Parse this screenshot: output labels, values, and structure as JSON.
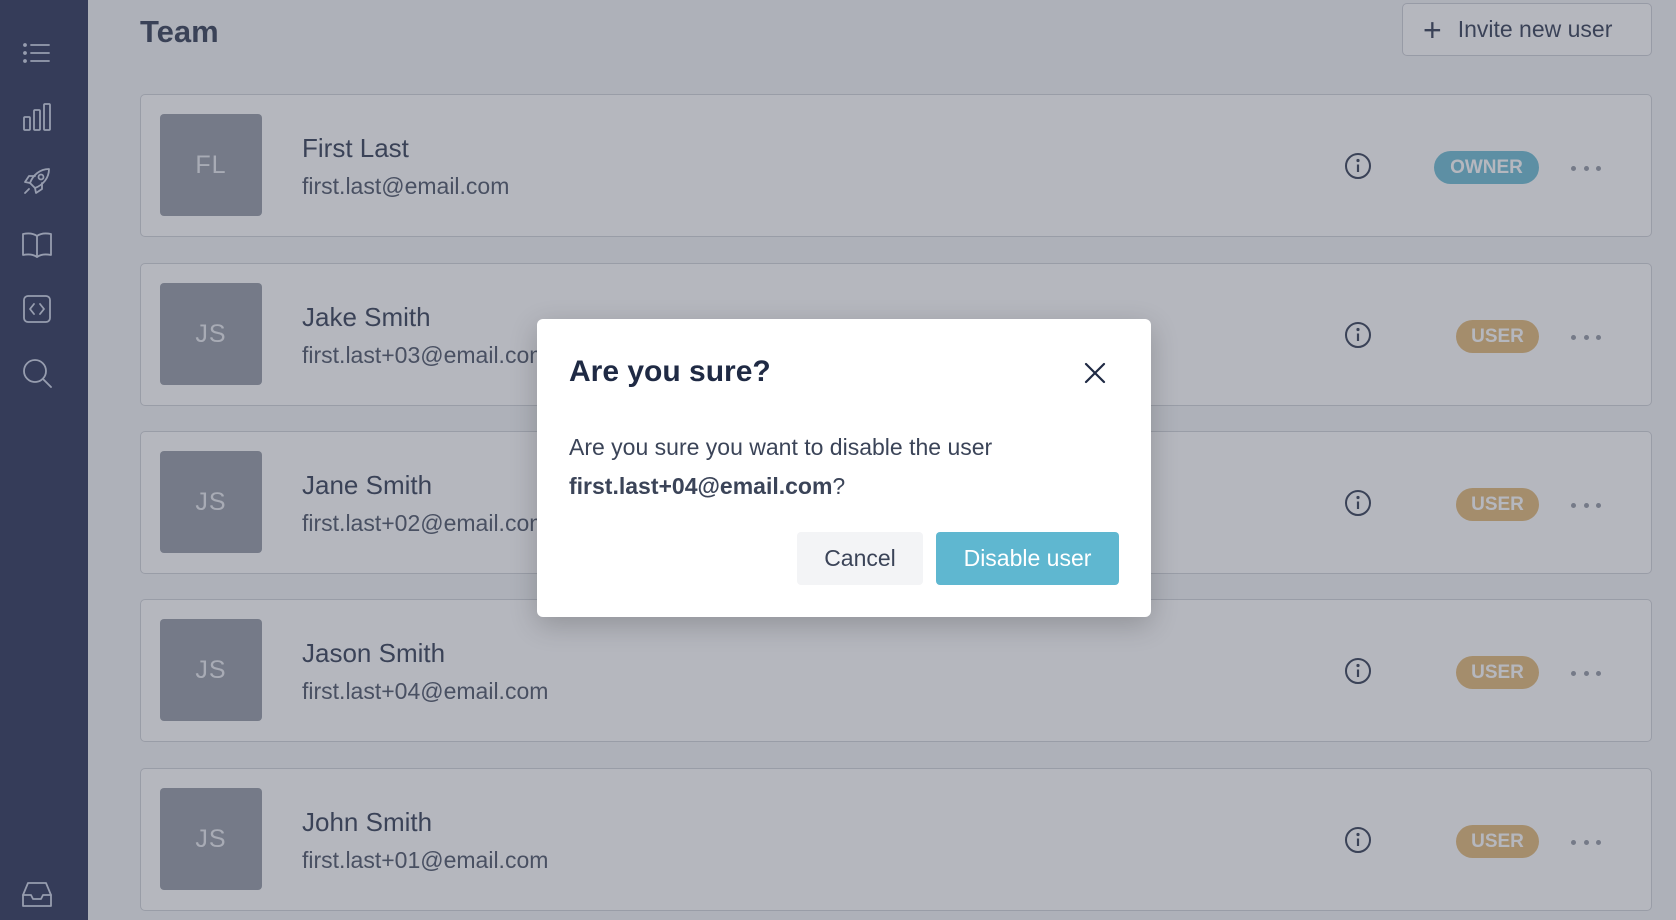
{
  "sidebar": {
    "icons": [
      "list-icon",
      "bar-chart-icon",
      "rocket-icon",
      "book-icon",
      "code-icon",
      "search-icon",
      "inbox-icon"
    ]
  },
  "header": {
    "title": "Team",
    "invite_label": "Invite new user"
  },
  "users": [
    {
      "initials": "FL",
      "name": "First Last",
      "email": "first.last@email.com",
      "role": "OWNER"
    },
    {
      "initials": "JS",
      "name": "Jake Smith",
      "email": "first.last+03@email.com",
      "role": "USER"
    },
    {
      "initials": "JS",
      "name": "Jane Smith",
      "email": "first.last+02@email.com",
      "role": "USER"
    },
    {
      "initials": "JS",
      "name": "Jason Smith",
      "email": "first.last+04@email.com",
      "role": "USER"
    },
    {
      "initials": "JS",
      "name": "John Smith",
      "email": "first.last+01@email.com",
      "role": "USER"
    }
  ],
  "modal": {
    "title": "Are you sure?",
    "body_prefix": "Are you sure you want to disable the user",
    "body_email": "first.last+04@email.com",
    "body_suffix": "?",
    "cancel_label": "Cancel",
    "confirm_label": "Disable user"
  },
  "colors": {
    "sidebar_bg": "#162048",
    "owner_badge": "#5fb7d0",
    "user_badge": "#e0b36b",
    "primary_button": "#5fb7d0"
  }
}
